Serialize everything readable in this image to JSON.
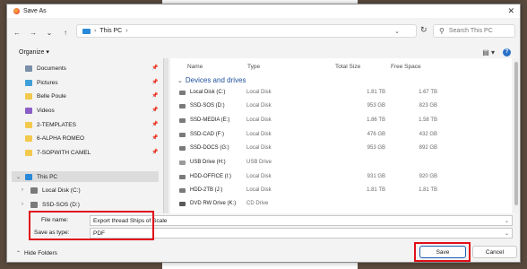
{
  "colors": {
    "accent": "#1a5fb4",
    "highlight": "#e0101a",
    "group_heading": "#1f4f9a"
  },
  "window": {
    "title": "Save As",
    "icon": "firefox-icon"
  },
  "address": {
    "location": "This PC",
    "search_placeholder": "Search This PC"
  },
  "toolbar": {
    "organize_label": "Organize ▾"
  },
  "navpane": {
    "quick_access": [
      {
        "label": "Documents",
        "icon": "documents-folder-icon",
        "color": "#7a8fa8"
      },
      {
        "label": "Pictures",
        "icon": "pictures-folder-icon",
        "color": "#3f9fd8"
      },
      {
        "label": "Belle Poule",
        "icon": "folder-icon",
        "color": "#f2c94c"
      },
      {
        "label": "Videos",
        "icon": "videos-folder-icon",
        "color": "#8b5fc7"
      },
      {
        "label": "2-TEMPLATES",
        "icon": "folder-icon",
        "color": "#f2c94c"
      },
      {
        "label": "6-ALPHA ROMEO",
        "icon": "folder-icon",
        "color": "#f2c94c"
      },
      {
        "label": "7-SOPWITH CAMEL",
        "icon": "folder-icon",
        "color": "#f2c94c"
      }
    ],
    "this_pc": "This PC",
    "drives": [
      {
        "label": "Local Disk (C:)",
        "icon": "hard-drive-icon"
      },
      {
        "label": "SSD-SOS (D:)",
        "icon": "hard-drive-icon"
      }
    ]
  },
  "filepane": {
    "columns": {
      "name": "Name",
      "type": "Type",
      "total_size": "Total Size",
      "free_space": "Free Space"
    },
    "group": "Devices and drives",
    "rows": [
      {
        "name": "Local Disk (C:)",
        "type": "Local Disk",
        "size": "1.81 TB",
        "free": "1.67 TB"
      },
      {
        "name": "SSD-SOS (D:)",
        "type": "Local Disk",
        "size": "953 GB",
        "free": "823 GB"
      },
      {
        "name": "SSD-MEDIA (E:)",
        "type": "Local Disk",
        "size": "1.86 TB",
        "free": "1.58 TB"
      },
      {
        "name": "SSD-CAD (F:)",
        "type": "Local Disk",
        "size": "476 GB",
        "free": "432 GB"
      },
      {
        "name": "SSD-DOCS (G:)",
        "type": "Local Disk",
        "size": "953 GB",
        "free": "892 GB"
      },
      {
        "name": "USB Drive (H:)",
        "type": "USB Drive",
        "size": "",
        "free": ""
      },
      {
        "name": "HDD-OFFICE (I:)",
        "type": "Local Disk",
        "size": "931 GB",
        "free": "920 GB"
      },
      {
        "name": "HDD-2TB (J:)",
        "type": "Local Disk",
        "size": "1.81 TB",
        "free": "1.81 TB"
      },
      {
        "name": "DVD RW Drive (K:)",
        "type": "CD Drive",
        "size": "",
        "free": ""
      }
    ]
  },
  "form": {
    "filename_label": "File name:",
    "filename_value": "Export thread Ships of Scale",
    "savetype_label": "Save as type:",
    "savetype_value": "PDF"
  },
  "footer": {
    "hide_folders": "Hide Folders",
    "save": "Save",
    "cancel": "Cancel"
  }
}
